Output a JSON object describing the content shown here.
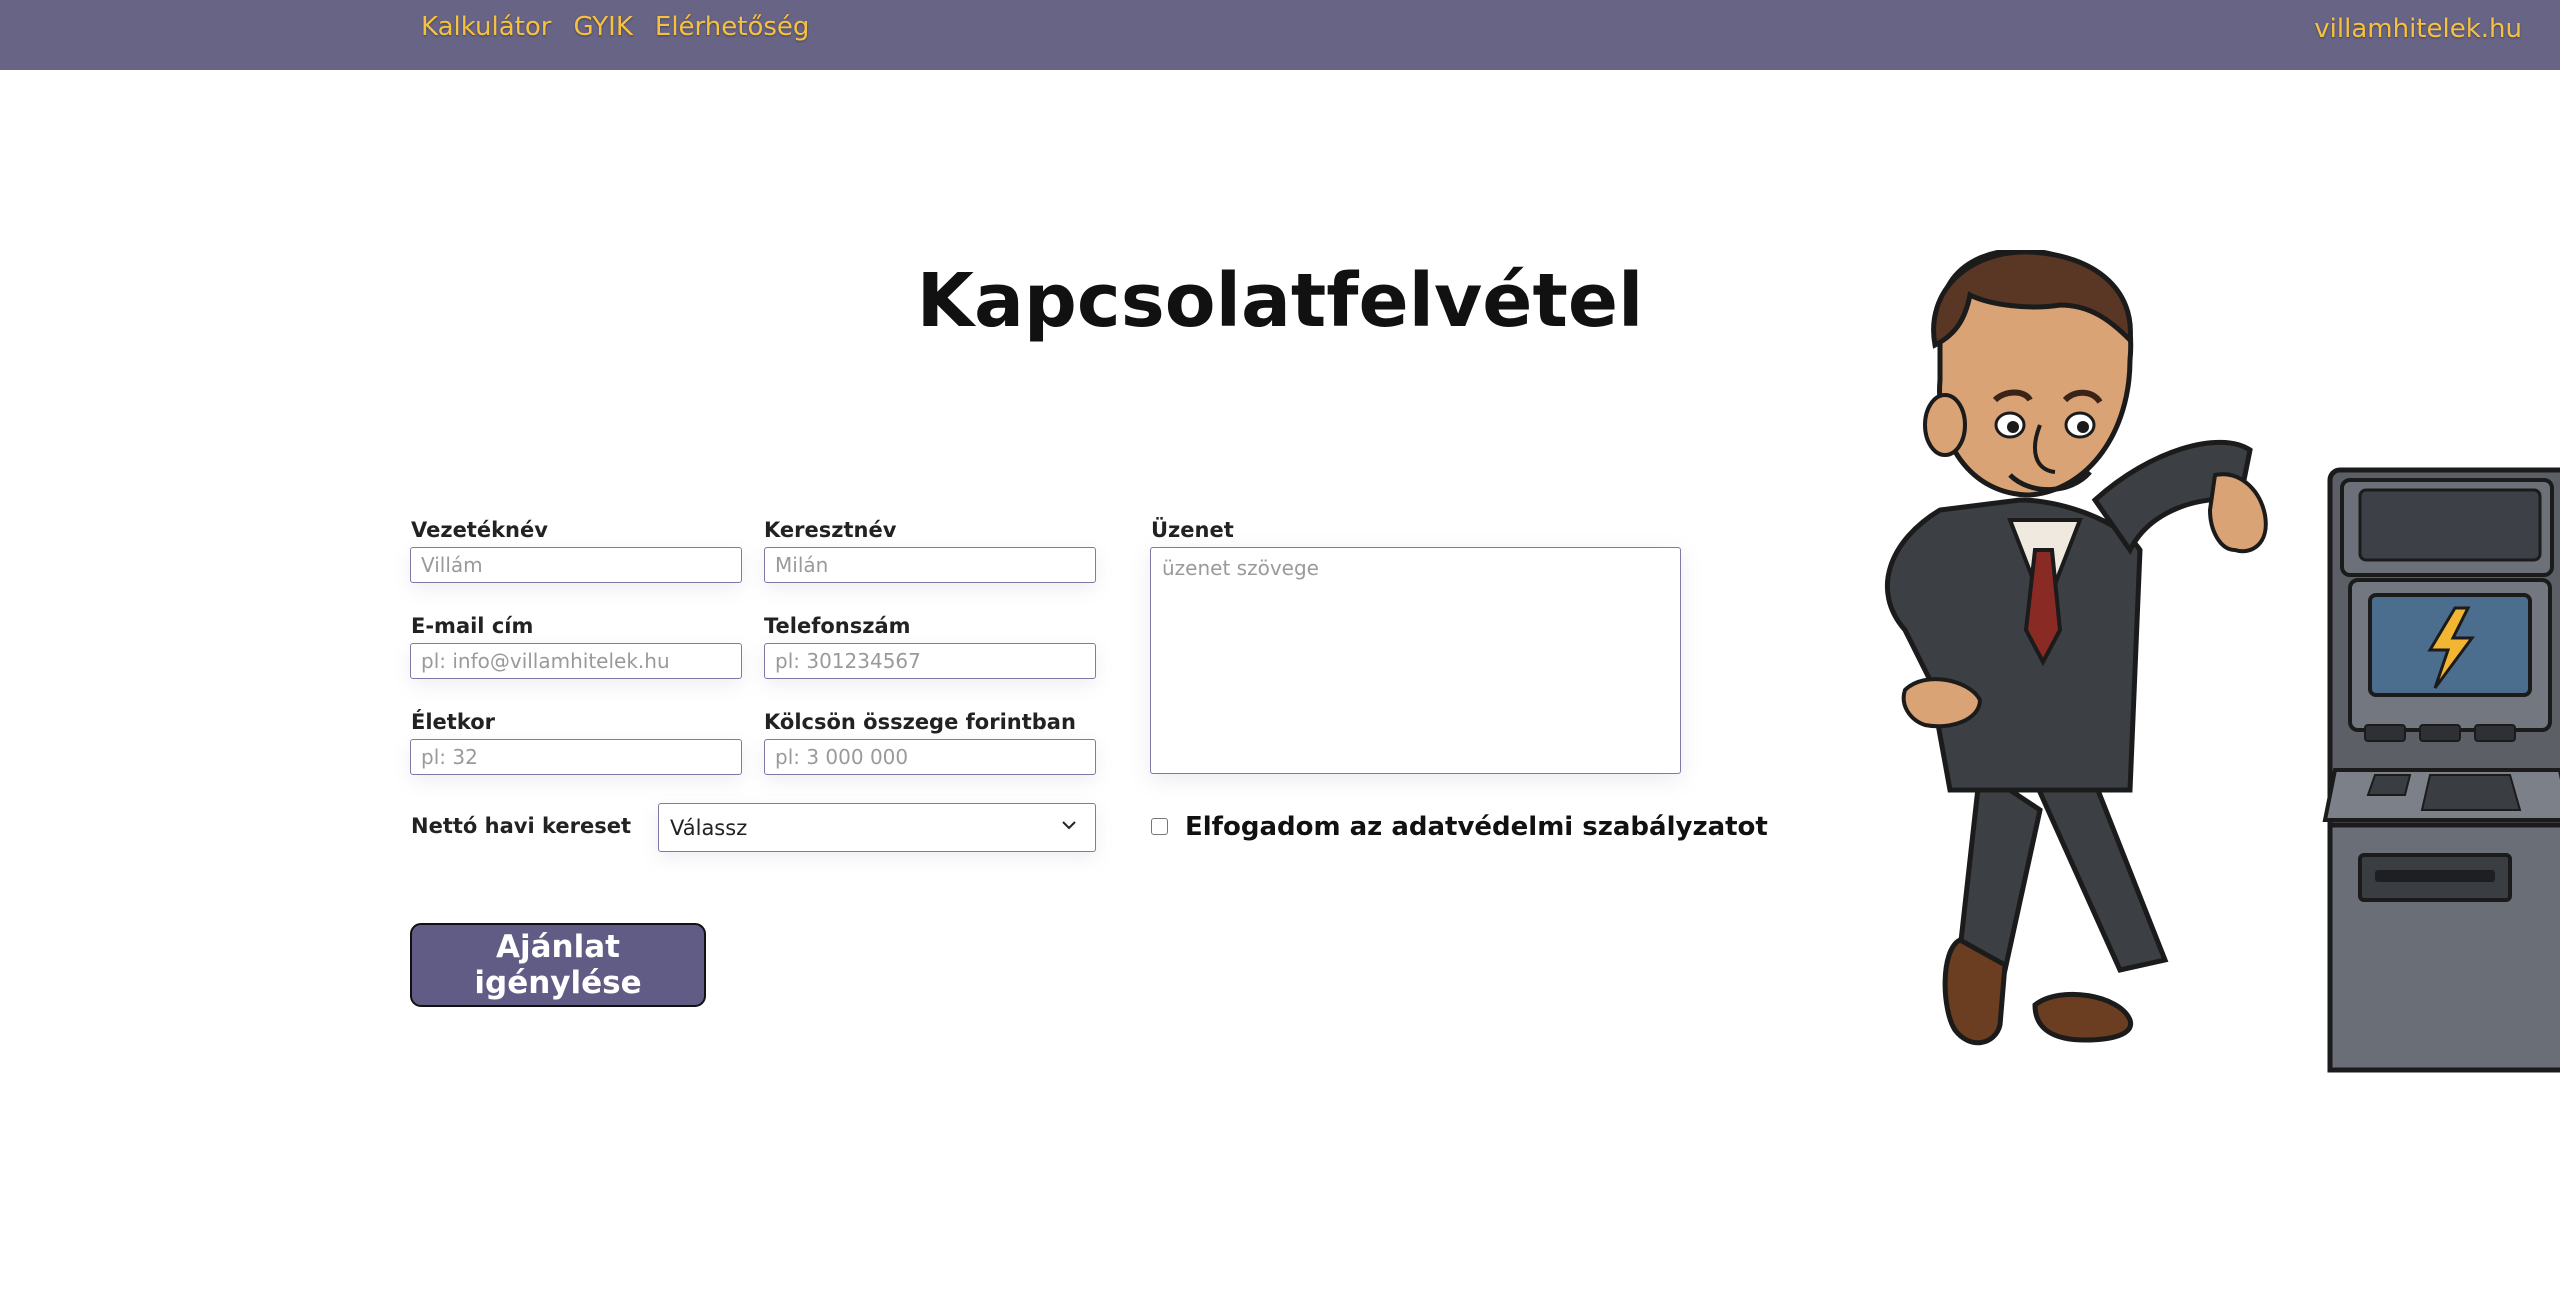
{
  "nav": {
    "items": [
      {
        "label": "Kalkulátor"
      },
      {
        "label": "GYIK"
      },
      {
        "label": "Elérhetőség"
      }
    ],
    "brand": "villamhitelek.hu"
  },
  "page_title": "Kapcsolatfelvétel",
  "form": {
    "last_name": {
      "label": "Vezetéknév",
      "placeholder": "Villám"
    },
    "first_name": {
      "label": "Keresztnév",
      "placeholder": "Milán"
    },
    "email": {
      "label": "E-mail cím",
      "placeholder": "pl: info@villamhitelek.hu"
    },
    "phone": {
      "label": "Telefonszám",
      "placeholder": "pl: 301234567"
    },
    "age": {
      "label": "Életkor",
      "placeholder": "pl: 32"
    },
    "loan_amount": {
      "label": "Kölcsön összege forintban",
      "placeholder": "pl: 3 000 000"
    },
    "income": {
      "label": "Nettó havi kereset",
      "selected": "Válassz"
    },
    "message": {
      "label": "Üzenet",
      "placeholder": "üzenet szövege"
    },
    "consent": {
      "label": "Elfogadom az adatvédelmi szabályzatot",
      "checked": false
    },
    "submit_label": "Ajánlat igénylése"
  },
  "colors": {
    "topbar": "#686486",
    "nav_text": "#f6c13f",
    "button": "#615c85",
    "input_border": "#7c7aa6"
  },
  "icons": {
    "select": "chevron-down-icon",
    "atm_screen": "lightning-icon"
  }
}
